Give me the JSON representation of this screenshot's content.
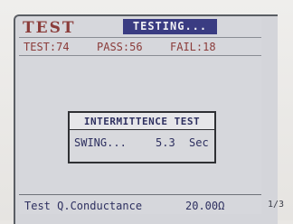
{
  "header": {
    "title": "TEST",
    "status": "TESTING..."
  },
  "counts": {
    "test": "TEST:74",
    "pass": "PASS:56",
    "fail": "FAIL:18"
  },
  "popup": {
    "title": "INTERMITTENCE TEST",
    "label": "SWING...",
    "value": "5.3",
    "unit": "Sec"
  },
  "footer": {
    "label": "Test Q.Conductance",
    "value": "20.00Ω"
  },
  "page_indicator": "1/3"
}
